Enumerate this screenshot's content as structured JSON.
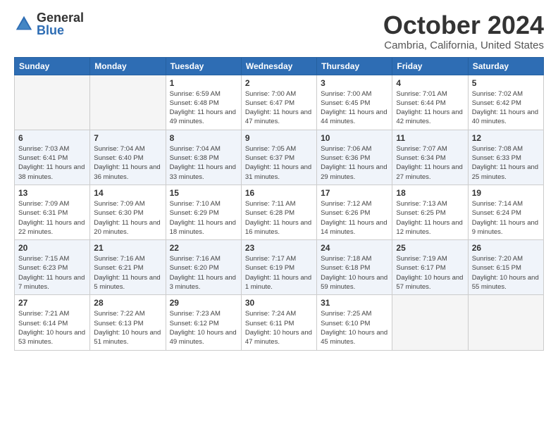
{
  "header": {
    "logo_general": "General",
    "logo_blue": "Blue",
    "month_title": "October 2024",
    "location": "Cambria, California, United States"
  },
  "weekdays": [
    "Sunday",
    "Monday",
    "Tuesday",
    "Wednesday",
    "Thursday",
    "Friday",
    "Saturday"
  ],
  "weeks": [
    [
      {
        "day": "",
        "info": ""
      },
      {
        "day": "",
        "info": ""
      },
      {
        "day": "1",
        "info": "Sunrise: 6:59 AM\nSunset: 6:48 PM\nDaylight: 11 hours and 49 minutes."
      },
      {
        "day": "2",
        "info": "Sunrise: 7:00 AM\nSunset: 6:47 PM\nDaylight: 11 hours and 47 minutes."
      },
      {
        "day": "3",
        "info": "Sunrise: 7:00 AM\nSunset: 6:45 PM\nDaylight: 11 hours and 44 minutes."
      },
      {
        "day": "4",
        "info": "Sunrise: 7:01 AM\nSunset: 6:44 PM\nDaylight: 11 hours and 42 minutes."
      },
      {
        "day": "5",
        "info": "Sunrise: 7:02 AM\nSunset: 6:42 PM\nDaylight: 11 hours and 40 minutes."
      }
    ],
    [
      {
        "day": "6",
        "info": "Sunrise: 7:03 AM\nSunset: 6:41 PM\nDaylight: 11 hours and 38 minutes."
      },
      {
        "day": "7",
        "info": "Sunrise: 7:04 AM\nSunset: 6:40 PM\nDaylight: 11 hours and 36 minutes."
      },
      {
        "day": "8",
        "info": "Sunrise: 7:04 AM\nSunset: 6:38 PM\nDaylight: 11 hours and 33 minutes."
      },
      {
        "day": "9",
        "info": "Sunrise: 7:05 AM\nSunset: 6:37 PM\nDaylight: 11 hours and 31 minutes."
      },
      {
        "day": "10",
        "info": "Sunrise: 7:06 AM\nSunset: 6:36 PM\nDaylight: 11 hours and 29 minutes."
      },
      {
        "day": "11",
        "info": "Sunrise: 7:07 AM\nSunset: 6:34 PM\nDaylight: 11 hours and 27 minutes."
      },
      {
        "day": "12",
        "info": "Sunrise: 7:08 AM\nSunset: 6:33 PM\nDaylight: 11 hours and 25 minutes."
      }
    ],
    [
      {
        "day": "13",
        "info": "Sunrise: 7:09 AM\nSunset: 6:31 PM\nDaylight: 11 hours and 22 minutes."
      },
      {
        "day": "14",
        "info": "Sunrise: 7:09 AM\nSunset: 6:30 PM\nDaylight: 11 hours and 20 minutes."
      },
      {
        "day": "15",
        "info": "Sunrise: 7:10 AM\nSunset: 6:29 PM\nDaylight: 11 hours and 18 minutes."
      },
      {
        "day": "16",
        "info": "Sunrise: 7:11 AM\nSunset: 6:28 PM\nDaylight: 11 hours and 16 minutes."
      },
      {
        "day": "17",
        "info": "Sunrise: 7:12 AM\nSunset: 6:26 PM\nDaylight: 11 hours and 14 minutes."
      },
      {
        "day": "18",
        "info": "Sunrise: 7:13 AM\nSunset: 6:25 PM\nDaylight: 11 hours and 12 minutes."
      },
      {
        "day": "19",
        "info": "Sunrise: 7:14 AM\nSunset: 6:24 PM\nDaylight: 11 hours and 9 minutes."
      }
    ],
    [
      {
        "day": "20",
        "info": "Sunrise: 7:15 AM\nSunset: 6:23 PM\nDaylight: 11 hours and 7 minutes."
      },
      {
        "day": "21",
        "info": "Sunrise: 7:16 AM\nSunset: 6:21 PM\nDaylight: 11 hours and 5 minutes."
      },
      {
        "day": "22",
        "info": "Sunrise: 7:16 AM\nSunset: 6:20 PM\nDaylight: 11 hours and 3 minutes."
      },
      {
        "day": "23",
        "info": "Sunrise: 7:17 AM\nSunset: 6:19 PM\nDaylight: 11 hours and 1 minute."
      },
      {
        "day": "24",
        "info": "Sunrise: 7:18 AM\nSunset: 6:18 PM\nDaylight: 10 hours and 59 minutes."
      },
      {
        "day": "25",
        "info": "Sunrise: 7:19 AM\nSunset: 6:17 PM\nDaylight: 10 hours and 57 minutes."
      },
      {
        "day": "26",
        "info": "Sunrise: 7:20 AM\nSunset: 6:15 PM\nDaylight: 10 hours and 55 minutes."
      }
    ],
    [
      {
        "day": "27",
        "info": "Sunrise: 7:21 AM\nSunset: 6:14 PM\nDaylight: 10 hours and 53 minutes."
      },
      {
        "day": "28",
        "info": "Sunrise: 7:22 AM\nSunset: 6:13 PM\nDaylight: 10 hours and 51 minutes."
      },
      {
        "day": "29",
        "info": "Sunrise: 7:23 AM\nSunset: 6:12 PM\nDaylight: 10 hours and 49 minutes."
      },
      {
        "day": "30",
        "info": "Sunrise: 7:24 AM\nSunset: 6:11 PM\nDaylight: 10 hours and 47 minutes."
      },
      {
        "day": "31",
        "info": "Sunrise: 7:25 AM\nSunset: 6:10 PM\nDaylight: 10 hours and 45 minutes."
      },
      {
        "day": "",
        "info": ""
      },
      {
        "day": "",
        "info": ""
      }
    ]
  ]
}
